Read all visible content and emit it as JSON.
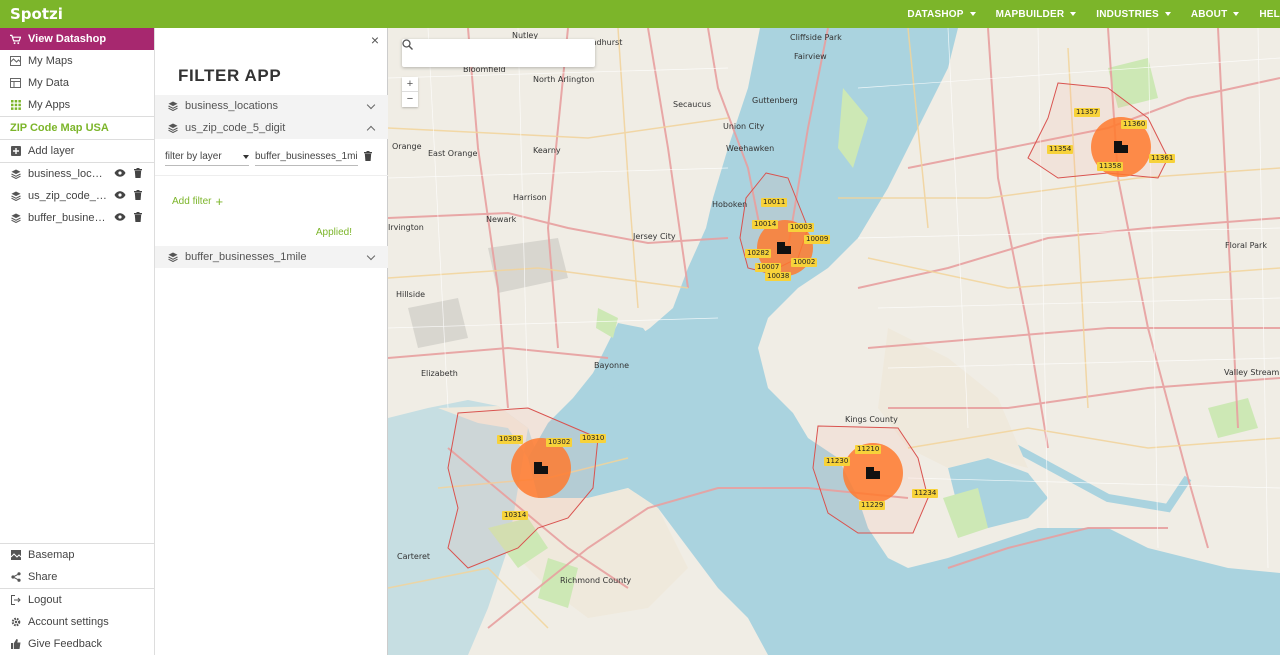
{
  "brand": {
    "logo": "Spotzi",
    "accent": "#7cb52a",
    "active": "#a7286f"
  },
  "topnav": [
    {
      "label": "DATASHOP"
    },
    {
      "label": "MAPBUILDER"
    },
    {
      "label": "INDUSTRIES"
    },
    {
      "label": "ABOUT"
    },
    {
      "label": "HEL"
    }
  ],
  "sidebar": {
    "view_datashop": "View Datashop",
    "my_maps": "My Maps",
    "my_data": "My Data",
    "my_apps": "My Apps",
    "map_title": "ZIP Code Map USA",
    "add_layer": "Add layer",
    "layers": [
      {
        "name": "business_locations"
      },
      {
        "name": "us_zip_code_5_digit"
      },
      {
        "name": "buffer_businesses_1..."
      }
    ],
    "basemap": "Basemap",
    "share": "Share",
    "logout": "Logout",
    "account_settings": "Account settings",
    "give_feedback": "Give Feedback"
  },
  "panel": {
    "title": "FILTER APP",
    "close": "×",
    "sections": [
      {
        "label": "business_locations"
      },
      {
        "label": "us_zip_code_5_digit"
      },
      {
        "label": "buffer_businesses_1mile"
      }
    ],
    "filter": {
      "type": "filter by layer",
      "layer": "buffer_businesses_1mile"
    },
    "add_filter": "Add filter",
    "add_icon": "+",
    "applied": "Applied!"
  },
  "map": {
    "zoom_in": "+",
    "zoom_out": "−",
    "search_placeholder": "",
    "places": [
      "Nutley",
      "Bloomfield",
      "North Arlington",
      "Secaucus",
      "Union City",
      "Guttenberg",
      "Fairview",
      "Cliffside Park",
      "Orange",
      "East Orange",
      "Kearny",
      "Weehawken",
      "Hoboken",
      "Harrison",
      "Newark",
      "Jersey City",
      "Irvington",
      "Hillside",
      "Bayonne",
      "Elizabeth",
      "Kings County",
      "Floral Park",
      "Valley Stream",
      "Carteret",
      "Richmond County",
      "Lyndhurst"
    ],
    "zips": [
      "11357",
      "11360",
      "11354",
      "11361",
      "11358",
      "10011",
      "10014",
      "10003",
      "10009",
      "10282",
      "10002",
      "10007",
      "10038",
      "10303",
      "10302",
      "10310",
      "10314",
      "11210",
      "11230",
      "11234",
      "11229"
    ]
  }
}
